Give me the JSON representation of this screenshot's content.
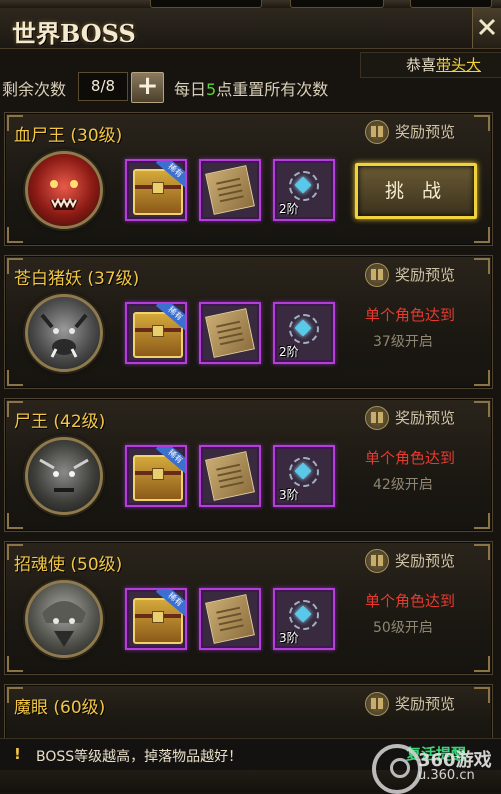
{
  "window": {
    "title": "世界BOSS"
  },
  "marquee": {
    "prefix": "恭喜",
    "highlight": "带头大"
  },
  "counter": {
    "label": "剩余次数",
    "value": "8/8",
    "plus": "+",
    "daily_prefix": "每日",
    "daily_count": "5",
    "daily_suffix": "点重置所有次数"
  },
  "bosses": [
    {
      "name": "血尸王 (30级)",
      "reward_label": "奖励预览",
      "items": [
        {
          "kind": "chest",
          "tier": ""
        },
        {
          "kind": "scroll",
          "tier": ""
        },
        {
          "kind": "amulet",
          "tier": "2阶"
        }
      ],
      "action_label": "挑 战",
      "locked": false
    },
    {
      "name": "苍白猪妖 (37级)",
      "reward_label": "奖励预览",
      "items": [
        {
          "kind": "chest",
          "tier": ""
        },
        {
          "kind": "scroll",
          "tier": ""
        },
        {
          "kind": "amulet",
          "tier": "2阶"
        }
      ],
      "lock_req": "单个角色达到",
      "lock_level": "37级开启",
      "locked": true
    },
    {
      "name": "尸王 (42级)",
      "reward_label": "奖励预览",
      "items": [
        {
          "kind": "chest",
          "tier": ""
        },
        {
          "kind": "scroll",
          "tier": ""
        },
        {
          "kind": "amulet",
          "tier": "3阶"
        }
      ],
      "lock_req": "单个角色达到",
      "lock_level": "42级开启",
      "locked": true
    },
    {
      "name": "招魂使 (50级)",
      "reward_label": "奖励预览",
      "items": [
        {
          "kind": "chest",
          "tier": ""
        },
        {
          "kind": "scroll",
          "tier": ""
        },
        {
          "kind": "amulet",
          "tier": "3阶"
        }
      ],
      "lock_req": "单个角色达到",
      "lock_level": "50级开启",
      "locked": true
    },
    {
      "name": "魔眼 (60级)",
      "reward_label": "奖励预览"
    }
  ],
  "footer": {
    "warn_icon": "!",
    "tip": "BOSS等级越高，掉落物品越好！",
    "revive": "复活提醒"
  },
  "watermark": {
    "brand": "360游戏",
    "url": "u.360.cn"
  },
  "colors": {
    "accent_gold": "#f2c646",
    "locked_red": "#e43a30",
    "item_frame_purple": "#b43fd8",
    "daily_green": "#59d43a"
  }
}
